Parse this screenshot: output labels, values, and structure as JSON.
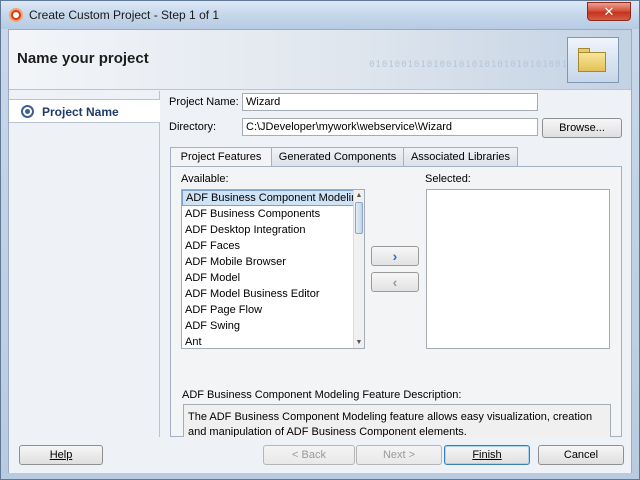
{
  "window": {
    "title": "Create Custom Project - Step 1 of 1",
    "close_glyph": "✕"
  },
  "header": {
    "title": "Name your project",
    "binary_pattern": "0101001010100101010101010101001"
  },
  "sidebar": {
    "items": [
      {
        "label": "Project Name",
        "icon": "radio-target-icon",
        "selected": true
      }
    ]
  },
  "form": {
    "project_name_label": "Project Name:",
    "project_name_value": "Wizard",
    "directory_label": "Directory:",
    "directory_value": "C:\\JDeveloper\\mywork\\webservice\\Wizard",
    "browse_label": "Browse..."
  },
  "tabs": [
    {
      "label": "Project Features",
      "active": true
    },
    {
      "label": "Generated Components",
      "active": false
    },
    {
      "label": "Associated Libraries",
      "active": false
    }
  ],
  "features": {
    "available_label": "Available:",
    "selected_label": "Selected:",
    "available_items": [
      "ADF Business Component Modeling",
      "ADF Business Components",
      "ADF Desktop Integration",
      "ADF Faces",
      "ADF Mobile Browser",
      "ADF Model",
      "ADF Model Business Editor",
      "ADF Page Flow",
      "ADF Swing",
      "Ant"
    ],
    "selected_index": 0,
    "selected_items": [],
    "add_glyph": "›",
    "remove_glyph": "‹",
    "description_label": "ADF Business Component Modeling Feature Description:",
    "description_text": "The ADF Business Component Modeling feature allows easy visualization, creation and manipulation of ADF Business Component elements."
  },
  "footer": {
    "help_label": "Help",
    "back_label": "< Back",
    "next_label": "Next >",
    "finish_label": "Finish",
    "cancel_label": "Cancel"
  },
  "colors": {
    "selection": "#cfe3f6",
    "nav_text": "#1f3a6b",
    "close_button": "#c3341f"
  }
}
